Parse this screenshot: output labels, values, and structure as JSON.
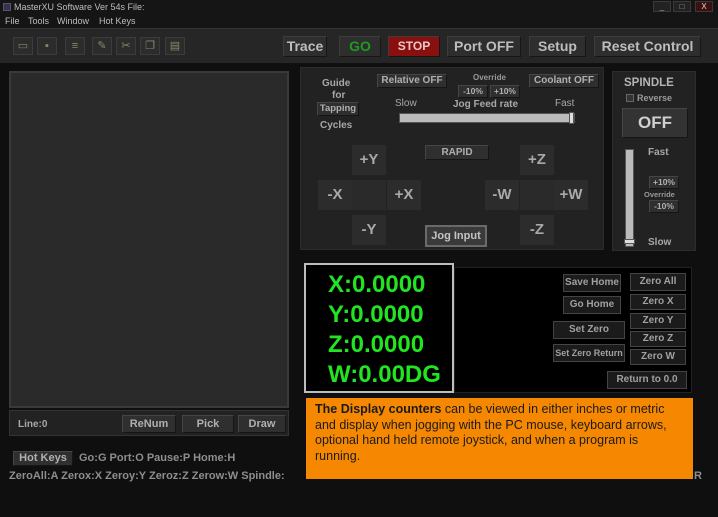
{
  "window": {
    "title": "MasterXU Software Ver 54s File:",
    "buttons": [
      "_",
      "□",
      "X"
    ]
  },
  "menu": [
    "File",
    "Tools",
    "Window",
    "Hot Keys"
  ],
  "toolbar": {
    "icons": [
      "open-icon",
      "save-icon",
      "print-icon",
      "edit-icon",
      "cut-icon",
      "copy-icon",
      "paste-icon"
    ],
    "trace": "Trace",
    "go": "GO",
    "stop": "STOP",
    "port": "Port OFF",
    "setup": "Setup",
    "reset": "Reset Control"
  },
  "editor": {
    "line": "Line:0",
    "renum": "ReNum",
    "pick": "Pick",
    "draw": "Draw"
  },
  "jog": {
    "guide": "Guide",
    "for": "for",
    "tapping": "Tapping",
    "cycles": "Cycles",
    "relative": "Relative OFF",
    "override": "Override",
    "ov_minus": "-10%",
    "ov_plus": "+10%",
    "coolant": "Coolant OFF",
    "slow": "Slow",
    "feed": "Jog Feed rate",
    "fast": "Fast",
    "rapid": "RAPID",
    "py": "+Y",
    "my": "-Y",
    "mx": "-X",
    "px": "+X",
    "pz": "+Z",
    "mz": "-Z",
    "mw": "-W",
    "pw": "+W",
    "input": "Jog Input"
  },
  "spindle": {
    "title": "SPINDLE",
    "reverse": "Reverse",
    "state": "OFF",
    "fast": "Fast",
    "plus": "+10%",
    "override": "Override",
    "minus": "-10%",
    "slow": "Slow"
  },
  "dro": {
    "x": "X:0.0000",
    "y": "Y:0.0000",
    "z": "Z:0.0000",
    "w": "W:0.00DG"
  },
  "dro_buttons": {
    "save_home": "Save Home",
    "go_home": "Go Home",
    "set_zero": "Set Zero",
    "set_zero_return": "Set Zero Return",
    "zero_all": "Zero All",
    "zero_x": "Zero X",
    "zero_y": "Zero Y",
    "zero_z": "Zero Z",
    "zero_w": "Zero W",
    "return": "Return to 0.0"
  },
  "callout": {
    "bold": "The Display counters",
    "text": " can be viewed in either inches or metric and display when jogging with the PC mouse, keyboard arrows, optional hand held remote joystick, and when a program is running."
  },
  "hotkeys": {
    "button": "Hot Keys",
    "line1": "Go:G  Port:O  Pause:P  Home:H",
    "line2": "ZeroAll:A  Zerox:X  Zeroy:Y  Zeroz:Z  Zerow:W  Spindle:",
    "trail": "R"
  }
}
